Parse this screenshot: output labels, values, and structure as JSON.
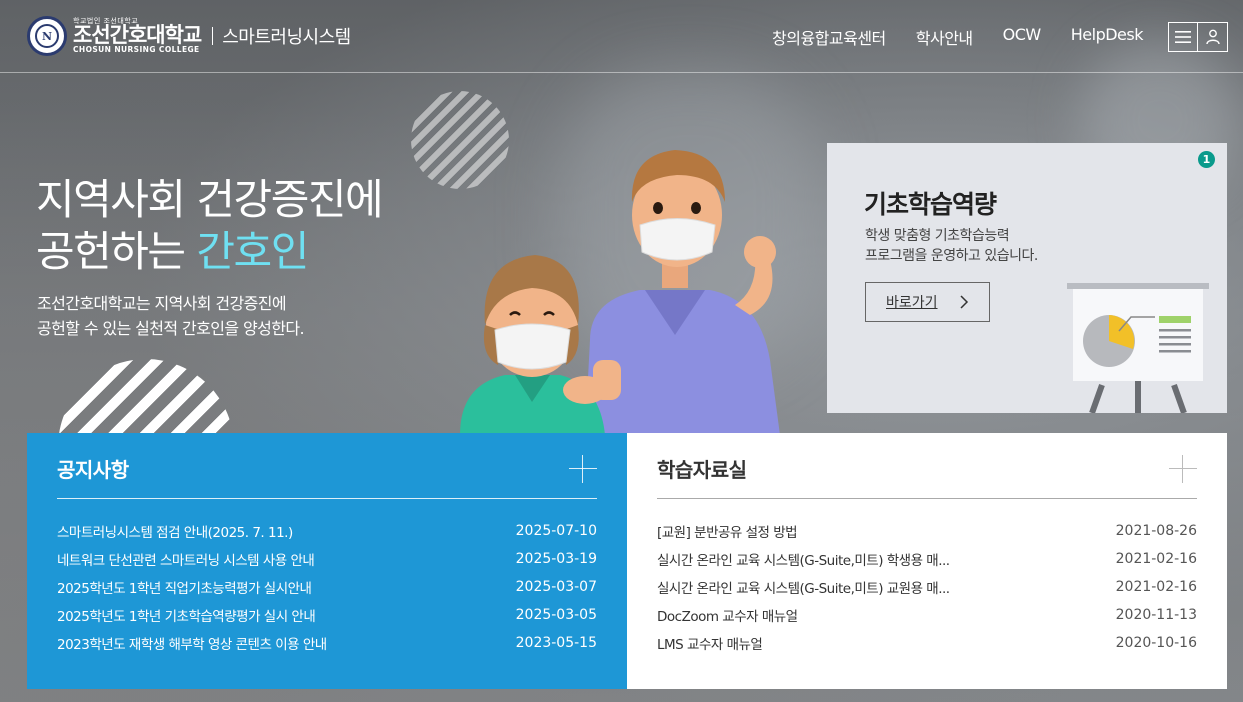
{
  "header": {
    "logo": {
      "emblem_text": "N",
      "small": "학교법인 조선대학교",
      "main": "조선간호대학교",
      "eng": "CHOSUN NURSING COLLEGE",
      "system": "스마트러닝시스템"
    },
    "nav": [
      {
        "label": "창의융합교육센터"
      },
      {
        "label": "학사안내"
      },
      {
        "label": "OCW"
      },
      {
        "label": "HelpDesk"
      }
    ],
    "icons": [
      "menu-icon",
      "user-icon"
    ]
  },
  "hero": {
    "title_line1": "지역사회 건강증진에",
    "title_line2_prefix": "공헌하는 ",
    "title_line2_accent": "간호인",
    "subtitle_line1": "조선간호대학교는 지역사회 건강증진에",
    "subtitle_line2": "공헌할 수 있는 실천적 간호인을 양성한다."
  },
  "promo": {
    "badge": "1",
    "title": "기초학습역량",
    "desc_line1": "학생 맞춤형 기초학습능력",
    "desc_line2": "프로그램을 운영하고 있습니다.",
    "button": "바로가기"
  },
  "notice": {
    "title": "공지사항",
    "items": [
      {
        "title": "스마트러닝시스템 점검 안내(2025. 7. 11.)",
        "date": "2025-07-10"
      },
      {
        "title": "네트워크 단선관련 스마트러닝 시스템 사용 안내",
        "date": "2025-03-19"
      },
      {
        "title": "2025학년도 1학년 직업기초능력평가 실시안내",
        "date": "2025-03-07"
      },
      {
        "title": "2025학년도 1학년 기초학습역량평가 실시 안내",
        "date": "2025-03-05"
      },
      {
        "title": "2023학년도 재학생 해부학 영상 콘텐츠 이용 안내",
        "date": "2023-05-15"
      }
    ]
  },
  "materials": {
    "title": "학습자료실",
    "items": [
      {
        "title": "[교원] 분반공유 설정 방법",
        "date": "2021-08-26"
      },
      {
        "title": "실시간 온라인 교육 시스템(G-Suite,미트) 학생용 매...",
        "date": "2021-02-16"
      },
      {
        "title": "실시간 온라인 교육 시스템(G-Suite,미트) 교원용 매...",
        "date": "2021-02-16"
      },
      {
        "title": "DocZoom 교수자 매뉴얼",
        "date": "2020-11-13"
      },
      {
        "title": "LMS 교수자 매뉴얼",
        "date": "2020-10-16"
      }
    ]
  },
  "colors": {
    "accent": "#6fe0f2",
    "notice_bg": "#1e97d6",
    "badge": "#0a9a8c"
  }
}
